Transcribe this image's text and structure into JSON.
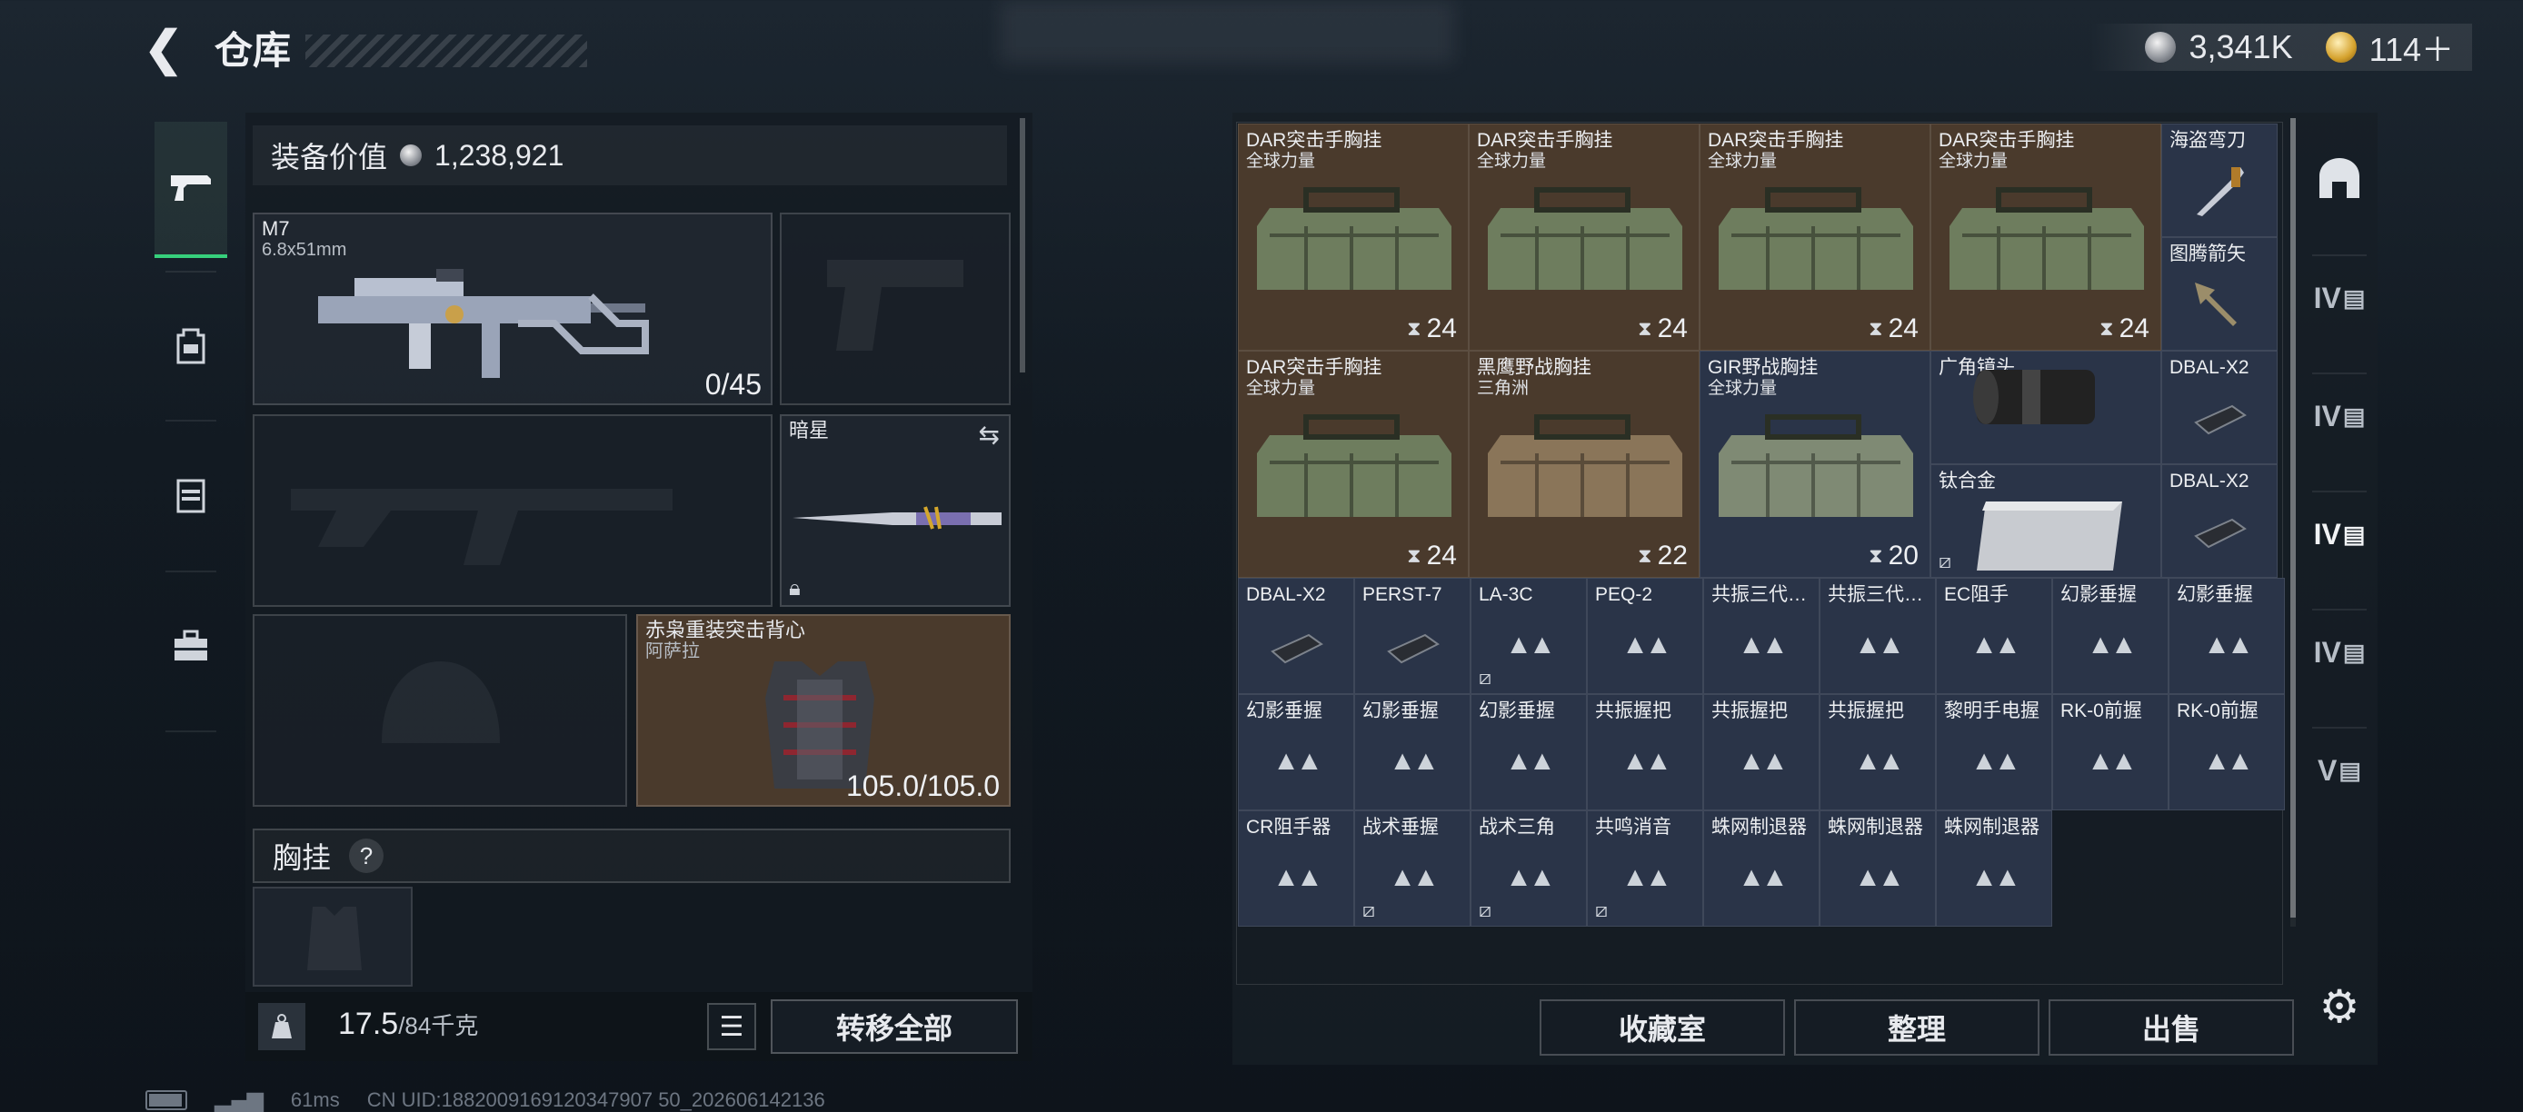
{
  "header": {
    "back_icon": "back-arrow-icon",
    "title": "仓库"
  },
  "currency": {
    "silver": "3,341K",
    "gold": "114＋"
  },
  "left_nav": [
    {
      "icon": "pistol-icon",
      "active": true
    },
    {
      "icon": "backpack-icon",
      "active": false
    },
    {
      "icon": "chest-rig-icon",
      "active": false
    },
    {
      "icon": "toolbox-icon",
      "active": false
    }
  ],
  "loadout": {
    "equip_value_label": "装备价值",
    "equip_value": "1,238,921",
    "primary": {
      "name": "M7",
      "ammo": "6.8x51mm",
      "count": "0/45"
    },
    "melee": {
      "name": "暗星"
    },
    "armor": {
      "name": "赤枭重装突击背心",
      "sub": "阿萨拉",
      "durability": "105.0/105.0"
    },
    "chest_rig_label": "胸挂",
    "help": "?",
    "weight": "17.5",
    "weight_max": "/84千克",
    "transfer_all": "转移全部"
  },
  "stash": {
    "bags": [
      {
        "name": "DAR突击手胸挂",
        "sub": "全球力量",
        "dur": "24",
        "color": "brown"
      },
      {
        "name": "DAR突击手胸挂",
        "sub": "全球力量",
        "dur": "24",
        "color": "brown"
      },
      {
        "name": "DAR突击手胸挂",
        "sub": "全球力量",
        "dur": "24",
        "color": "brown"
      },
      {
        "name": "DAR突击手胸挂",
        "sub": "全球力量",
        "dur": "24",
        "color": "brown"
      },
      {
        "name": "DAR突击手胸挂",
        "sub": "全球力量",
        "dur": "24",
        "color": "brown"
      },
      {
        "name": "黑鹰野战胸挂",
        "sub": "三角洲",
        "dur": "22",
        "color": "brown"
      },
      {
        "name": "GIR野战胸挂",
        "sub": "全球力量",
        "dur": "20",
        "color": "navy"
      }
    ],
    "side_items": [
      "海盗弯刀",
      "图腾箭矢",
      "DBAL-X2",
      "DBAL-X2"
    ],
    "lens": "广角镜头",
    "titanium": "钛合金",
    "small_items": [
      [
        "DBAL-X2",
        "PERST-7",
        "LA-3C",
        "PEQ-2",
        "共振三代…",
        "共振三代…",
        "EC阻手",
        "幻影垂握",
        "幻影垂握"
      ],
      [
        "幻影垂握",
        "幻影垂握",
        "幻影垂握",
        "共振握把",
        "共振握把",
        "共振握把",
        "黎明手电握",
        "RK-0前握",
        "RK-0前握"
      ],
      [
        "CR阻手器",
        "战术垂握",
        "战术三角",
        "共鸣消音",
        "蛛网制退器",
        "蛛网制退器",
        "蛛网制退器"
      ]
    ],
    "buttons": {
      "collection": "收藏室",
      "sort": "整理",
      "sell": "出售"
    }
  },
  "right_nav": [
    "IV",
    "IV",
    "IV",
    "IV",
    "V"
  ],
  "status": {
    "ping": "61ms",
    "uid": "CN UID:1882009169120347907 50_202606142136"
  },
  "colors": {
    "accent_green": "#36d07c",
    "brown_cell": "#4a3a2c",
    "navy_cell": "#2a3448"
  }
}
